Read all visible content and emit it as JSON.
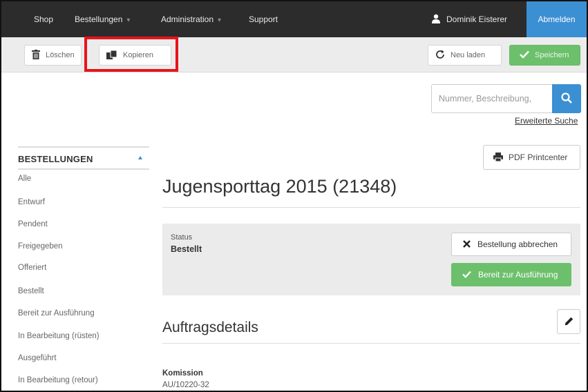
{
  "nav": {
    "items": [
      {
        "label": "Shop",
        "caret": false
      },
      {
        "label": "Bestellungen",
        "caret": true
      },
      {
        "label": "Administration",
        "caret": true
      },
      {
        "label": "Support",
        "caret": false
      }
    ],
    "user_name": "Dominik Eisterer",
    "logout_label": "Abmelden",
    "caret_glyph": "▾"
  },
  "toolbar": {
    "delete_label": "Löschen",
    "copy_label": "Kopieren",
    "reload_label": "Neu laden",
    "save_label": "Speichern"
  },
  "search": {
    "placeholder": "Nummer, Beschreibung,",
    "advanced_label": "Erweiterte Suche"
  },
  "sidebar": {
    "title": "BESTELLUNGEN",
    "items": [
      {
        "label": "Alle"
      },
      {
        "label": "Entwurf"
      },
      {
        "label": "Pendent"
      },
      {
        "label": "Freigegeben"
      },
      {
        "label": "Offeriert"
      },
      {
        "label": "Bestellt"
      },
      {
        "label": "Bereit zur Ausführung"
      },
      {
        "label": "In Bearbeitung (rüsten)"
      },
      {
        "label": "Ausgeführt"
      },
      {
        "label": "In Bearbeitung (retour)"
      }
    ]
  },
  "main": {
    "pdf_label": "PDF Printcenter",
    "title": "Jugensporttag 2015 (21348)",
    "status": {
      "label": "Status",
      "value": "Bestellt",
      "cancel_label": "Bestellung abbrechen",
      "ready_label": "Bereit zur Ausführung"
    },
    "section_title": "Auftragsdetails",
    "fields": {
      "komission_label": "Komission",
      "komission_value": "AU/10220-32"
    }
  },
  "colors": {
    "nav_bg": "#2c2c2c",
    "accent_blue": "#3b8fd3",
    "success_green": "#6cc06c",
    "highlight_red": "#e8141b"
  }
}
